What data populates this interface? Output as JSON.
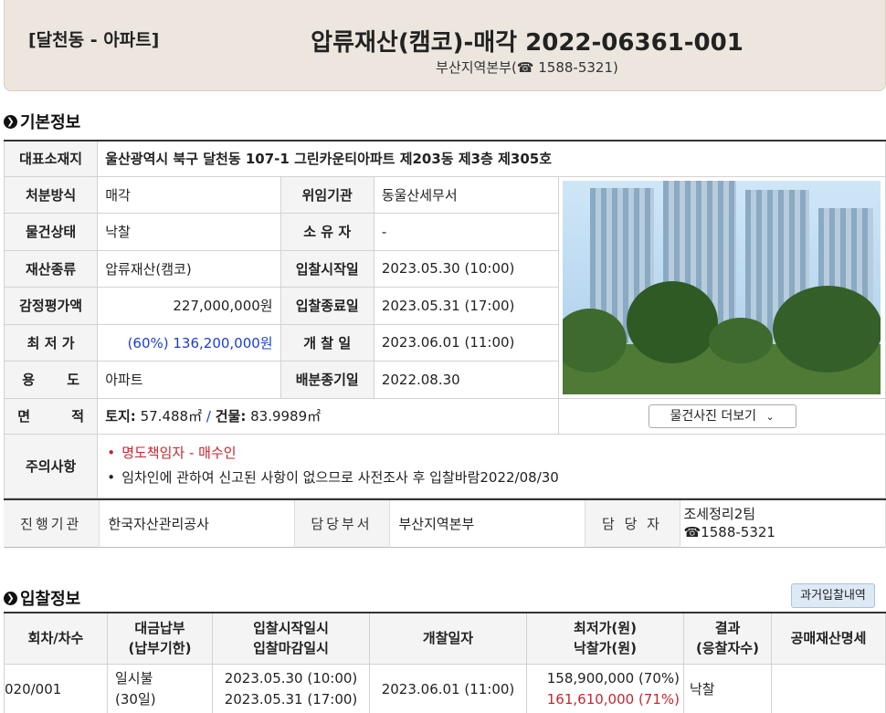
{
  "header": {
    "location": "[달천동 - 아파트]",
    "title": "압류재산(캠코)-매각 2022-06361-001",
    "office": "부산지역본부(☎ 1588-5321)"
  },
  "basic": {
    "section_title": "기본정보",
    "address_label": "대표소재지",
    "address_value": "울산광역시 북구 달천동 107-1 그린카운티아파트 제203동 제3층 제305호",
    "disposal_label": "처분방식",
    "disposal_value": "매각",
    "delegator_label": "위임기관",
    "delegator_value": "동울산세무서",
    "status_label": "물건상태",
    "status_value": "낙찰",
    "owner_label": "소 유 자",
    "owner_value": "-",
    "type_label": "재산종류",
    "type_value": "압류재산(캠코)",
    "bid_start_label": "입찰시작일",
    "bid_start_value": "2023.05.30 (10:00)",
    "appraisal_label": "감정평가액",
    "appraisal_value": "227,000,000원",
    "bid_end_label": "입찰종료일",
    "bid_end_value": "2023.05.31 (17:00)",
    "min_price_label": "최 저 가",
    "min_price_value": "(60%) 136,200,000원",
    "opening_label": "개 찰 일",
    "opening_value": "2023.06.01 (11:00)",
    "use_label": "용 도",
    "use_value": "아파트",
    "distribution_label": "배분종기일",
    "distribution_value": "2022.08.30",
    "area_label": "면 적",
    "area_land_label": "토지:",
    "area_land_value": "57.488㎡",
    "area_sep": "/",
    "area_bldg_label": "건물:",
    "area_bldg_value": "83.9989㎡",
    "more_photos": "물건사진 더보기",
    "notice_label": "주의사항",
    "notices": [
      "명도책임자 - 매수인",
      "임차인에 관하여 신고된 사항이 없으므로 사전조사 후 입찰바람2022/08/30"
    ]
  },
  "agency": {
    "org_label": "진행기관",
    "org_value": "한국자산관리공사",
    "dept_label": "담당부서",
    "dept_value": "부산지역본부",
    "person_label": "담 당 자",
    "person_team": "조세정리2팀",
    "person_phone": "☎1588-5321"
  },
  "bid": {
    "section_title": "입찰정보",
    "history_button": "과거입찰내역",
    "headers": {
      "round": "회차/차수",
      "payment_1": "대금납부",
      "payment_2": "(납부기한)",
      "period_1": "입찰시작일시",
      "period_2": "입찰마감일시",
      "opening": "개찰일자",
      "price_1": "최저가(원)",
      "price_2": "낙찰가(원)",
      "result_1": "결과",
      "result_2": "(응찰자수)",
      "statement": "공매재산명세"
    },
    "row": {
      "round": "020/001",
      "payment_1": "일시불",
      "payment_2": "(30일)",
      "start": "2023.05.30 (10:00)",
      "end": "2023.05.31 (17:00)",
      "opening": "2023.06.01 (11:00)",
      "min_price": "158,900,000 (70%)",
      "win_price": "161,610,000 (71%)",
      "result": "낙찰"
    }
  },
  "colors": {
    "blue_price": "#1a3fd0",
    "red_text": "#c6262e",
    "header_bg": "#ece6de"
  }
}
